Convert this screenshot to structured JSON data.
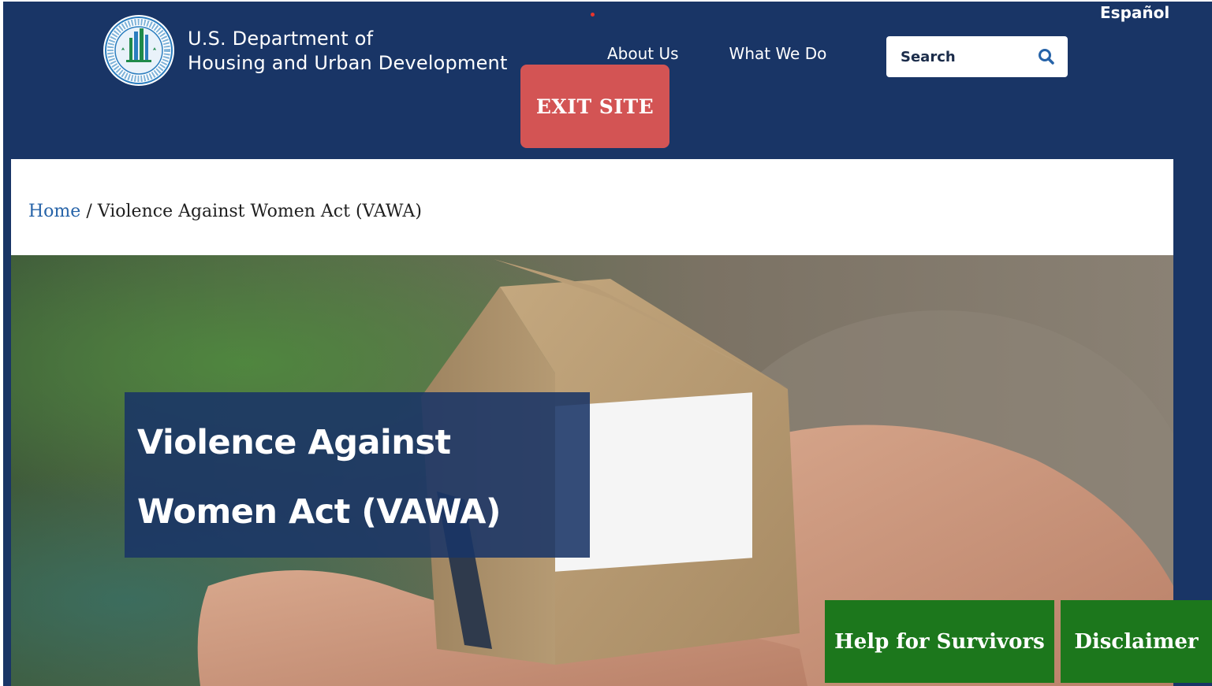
{
  "header": {
    "agency_line1": "U.S. Department of",
    "agency_line2": "Housing and Urban Development",
    "seal_icon": "hud-seal-logo",
    "language_link": "Español",
    "nav": [
      {
        "label": "About Us"
      },
      {
        "label": "What We Do"
      }
    ],
    "search": {
      "placeholder": "Search",
      "icon": "search-icon"
    },
    "exit_label": "EXIT SITE"
  },
  "breadcrumb": {
    "home": "Home",
    "separator": "/",
    "current": "Violence Against Women Act (VAWA)"
  },
  "hero": {
    "title": "Violence Against Women Act (VAWA)",
    "image_alt": "Hands holding a small cardboard house"
  },
  "actions": {
    "help_label": "Help for Survivors",
    "disclaimer_label": "Disclaimer"
  },
  "colors": {
    "navy": "#193566",
    "exit_red": "#d35454",
    "action_green": "#1c771c",
    "link_blue": "#2663a8"
  }
}
